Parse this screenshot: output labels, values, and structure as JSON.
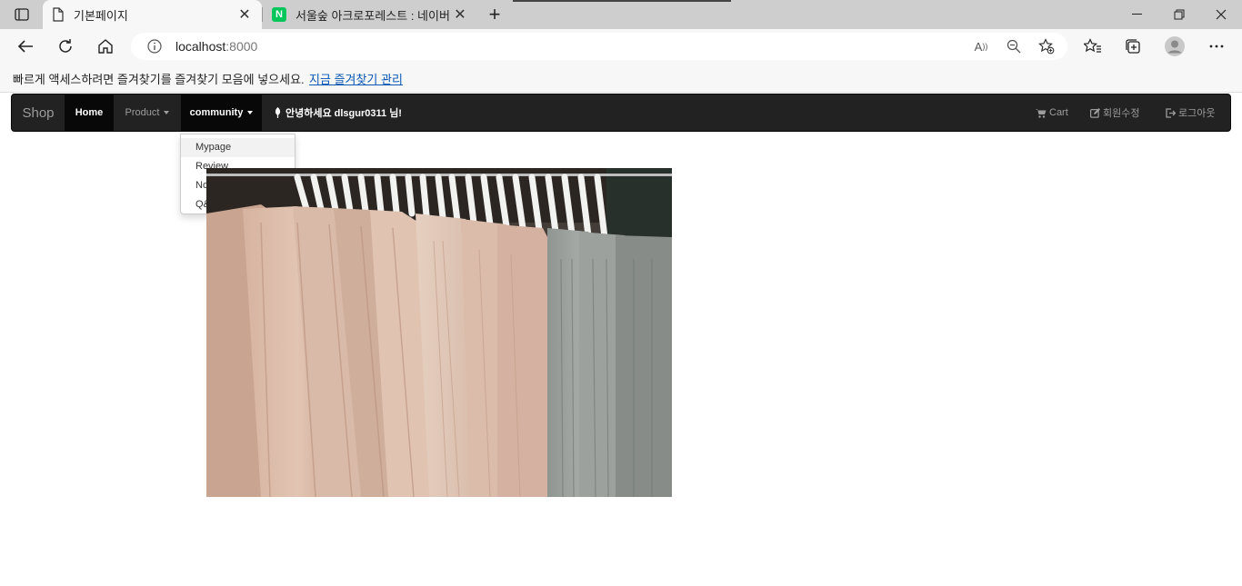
{
  "browser": {
    "tabs": [
      {
        "title": "기본페이지",
        "active": true
      },
      {
        "title": "서울숲 아크로포레스트 : 네이버",
        "active": false,
        "favicon_letter": "N",
        "favicon_color": "#03c75a"
      }
    ],
    "address": {
      "host": "localhost",
      "port": ":8000"
    },
    "favorites_bar": {
      "text": "빠르게 액세스하려면 즐겨찾기를 즐겨찾기 모음에 넣으세요.",
      "link": "지금 즐겨찾기 관리"
    }
  },
  "navbar": {
    "brand": "Shop",
    "home": "Home",
    "product": "Product",
    "community": "community",
    "greeting": "안녕하세요 dlsgur0311 님!",
    "cart": "Cart",
    "edit_profile": "회원수정",
    "logout": "로그아웃"
  },
  "dropdown": {
    "items": [
      "Mypage",
      "Review",
      "Notice",
      "Q&A"
    ]
  },
  "colors": {
    "navbar_bg": "#222222",
    "active_bg": "#080808",
    "link_color": "#0a58b3"
  }
}
